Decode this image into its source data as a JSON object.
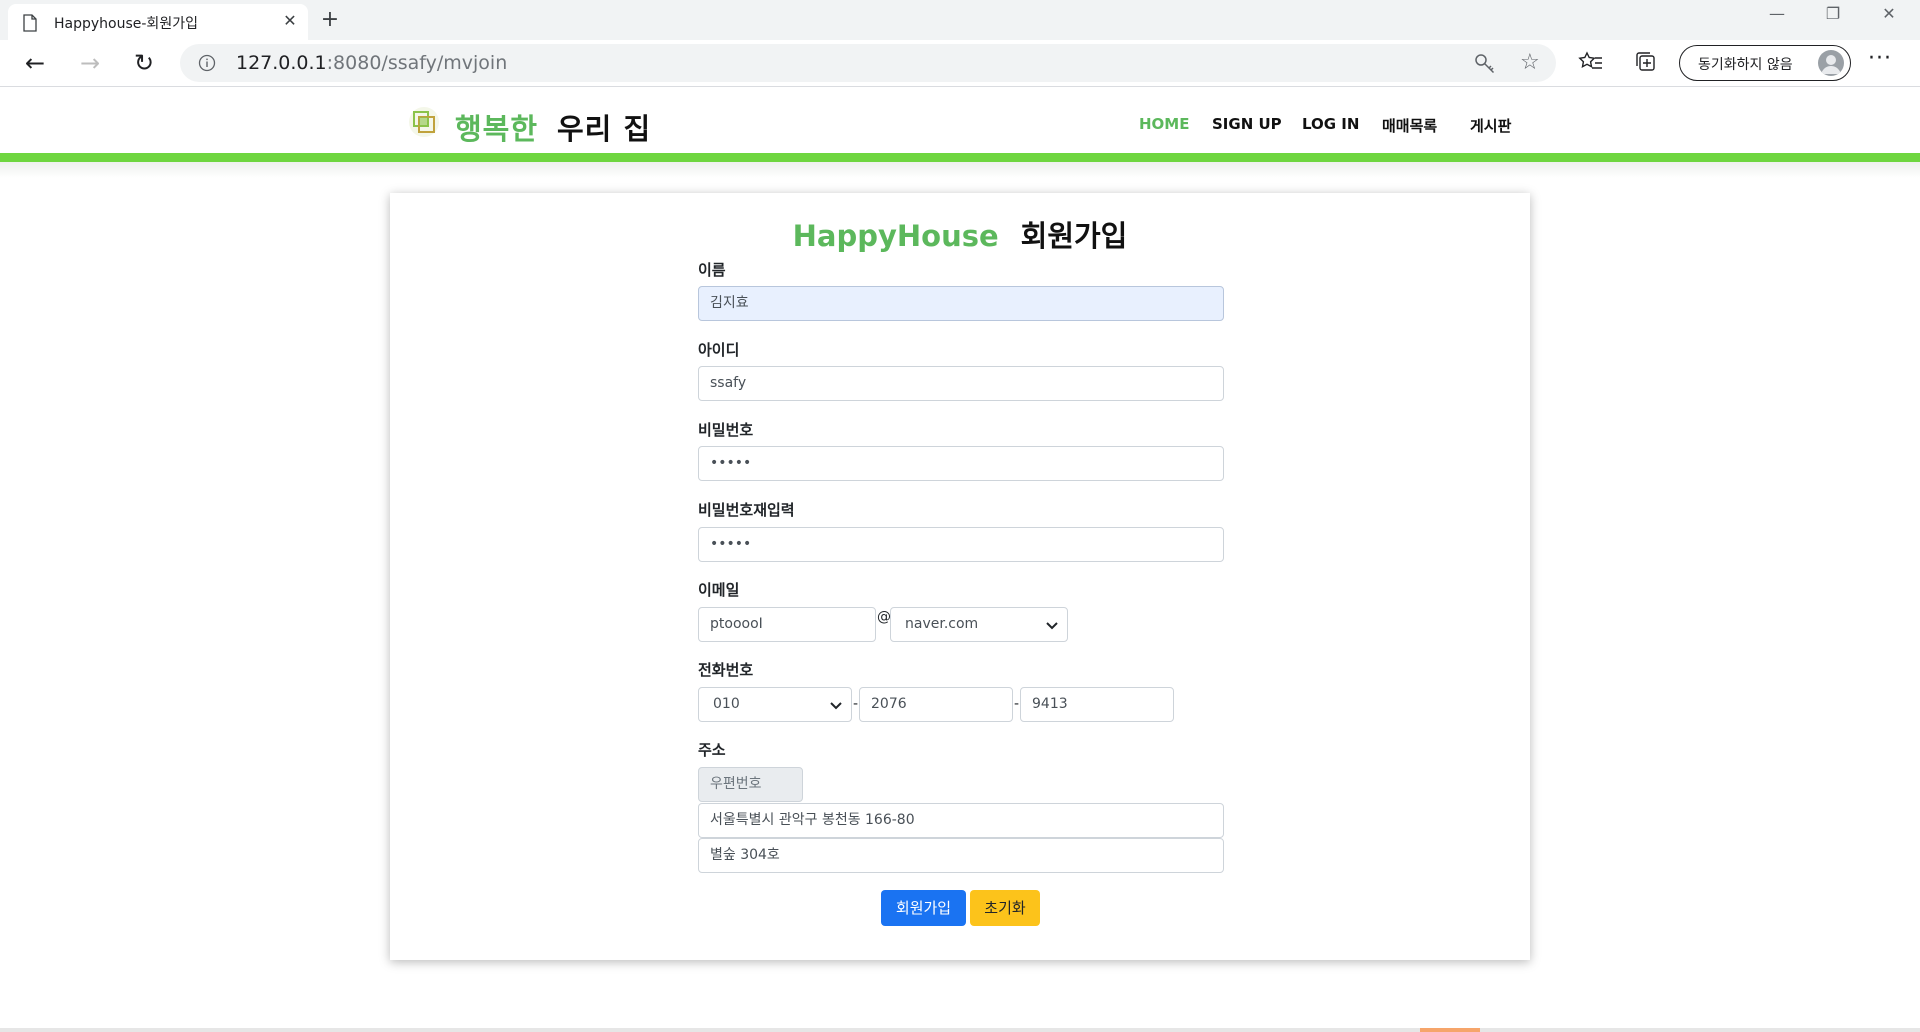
{
  "browser": {
    "tab_title": "Happyhouse-회원가입",
    "url_host": "127.0.0.1",
    "url_rest": ":8080/ssafy/mvjoin",
    "sync_label": "동기화하지 않음"
  },
  "site": {
    "logo_green": "행복한",
    "logo_black": "우리 집",
    "menu": [
      "HOME",
      "SIGN UP",
      "LOG IN",
      "매매목록",
      "게시판"
    ],
    "accent_color": "#5cb85c",
    "bar_color": "#6fd640"
  },
  "form": {
    "title_green": "HappyHouse",
    "title_black": "회원가입",
    "name_label": "이름",
    "name_value": "김지효",
    "id_label": "아이디",
    "id_value": "ssafy",
    "pw_label": "비밀번호",
    "pw_value": "•••••",
    "pw2_label": "비밀번호재입력",
    "pw2_value": "•••••",
    "email_label": "이메일",
    "email_id": "ptooooI",
    "email_at": "@",
    "email_domain": "naver.com",
    "phone_label": "전화번호",
    "phone_first": "010",
    "phone_sep": "-",
    "phone_mid": "2076",
    "phone_last": "9413",
    "address_label": "주소",
    "zipcode_placeholder": "우편번호",
    "address_1": "서울특별시 관악구 봉천동 166-80",
    "address_2": "별숲 304호",
    "join_button": "회원가입",
    "reset_button": "초기화",
    "join_color": "#1a73f2",
    "reset_color": "#fcc31b"
  }
}
